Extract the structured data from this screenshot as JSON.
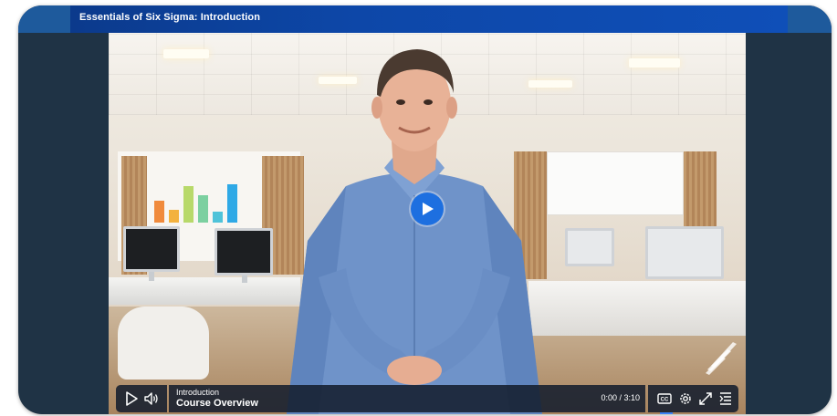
{
  "window": {
    "title": "Essentials of Six Sigma: Introduction"
  },
  "player": {
    "chapter_label": "Introduction",
    "chapter_title": "Course Overview",
    "time_display": "0:00 / 3:10",
    "progress_fraction": 0,
    "state": "paused"
  },
  "icons": {
    "play": "play-icon",
    "volume": "volume-icon",
    "captions": "closed-captions-icon",
    "settings": "gear-icon",
    "fullscreen": "fullscreen-icon",
    "transcript": "transcript-list-icon",
    "center_play": "play-circle-icon",
    "logo": "brand-logo-watermark"
  },
  "colors": {
    "accent": "#1d6fe0",
    "title_bar": "#0d47a8",
    "frame_bg": "#1f3345",
    "control_bg": "#141e2d"
  }
}
